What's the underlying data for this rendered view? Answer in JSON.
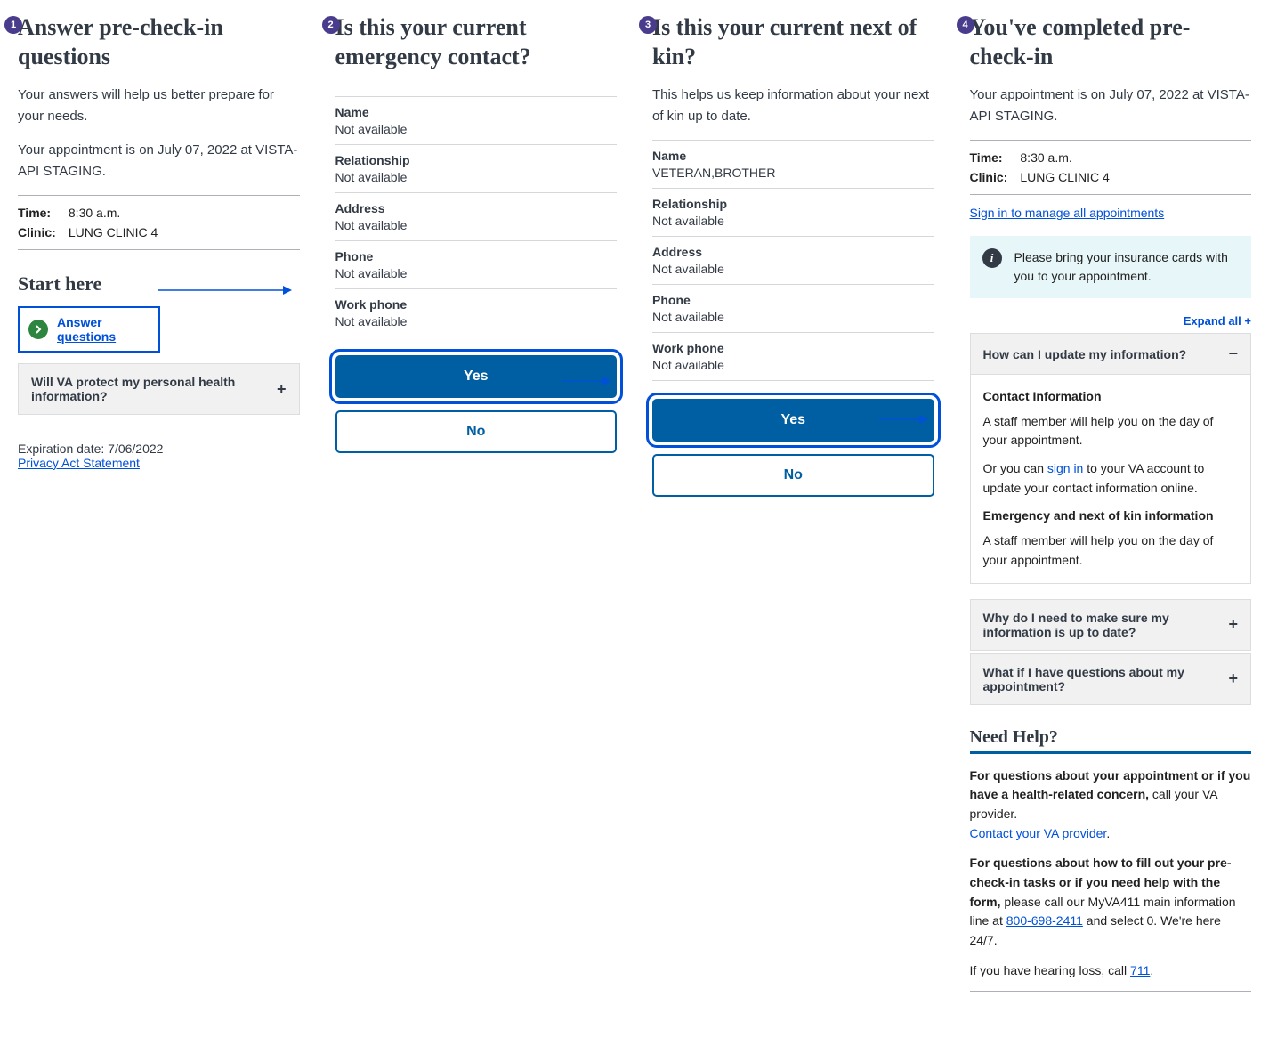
{
  "panels": {
    "p1": {
      "step": "1",
      "title": "Answer pre-check-in questions",
      "intro": "Your answers will help us better prepare for your needs.",
      "appt": "Your appointment is on July 07, 2022 at VISTA-API STAGING.",
      "time_label": "Time:",
      "time_value": "8:30 a.m.",
      "clinic_label": "Clinic:",
      "clinic_value": "LUNG CLINIC 4",
      "start_heading": "Start here",
      "answer_link": "Answer questions",
      "accordion1": "Will VA protect my personal health information?",
      "expiration": "Expiration date: 7/06/2022",
      "privacy": "Privacy Act Statement"
    },
    "p2": {
      "step": "2",
      "title": "Is this your current emergency contact?",
      "fields": [
        {
          "label": "Name",
          "value": "Not available"
        },
        {
          "label": "Relationship",
          "value": "Not available"
        },
        {
          "label": "Address",
          "value": "Not available"
        },
        {
          "label": "Phone",
          "value": "Not available"
        },
        {
          "label": "Work phone",
          "value": "Not available"
        }
      ],
      "yes": "Yes",
      "no": "No"
    },
    "p3": {
      "step": "3",
      "title": "Is this your current next of kin?",
      "intro": "This helps us keep information about your next of kin up to date.",
      "fields": [
        {
          "label": "Name",
          "value": "VETERAN,BROTHER"
        },
        {
          "label": "Relationship",
          "value": "Not available"
        },
        {
          "label": "Address",
          "value": "Not available"
        },
        {
          "label": "Phone",
          "value": "Not available"
        },
        {
          "label": "Work phone",
          "value": "Not available"
        }
      ],
      "yes": "Yes",
      "no": "No"
    },
    "p4": {
      "step": "4",
      "title": "You've completed pre-check-in",
      "appt": "Your appointment is on July 07, 2022 at VISTA-API STAGING.",
      "time_label": "Time:",
      "time_value": "8:30 a.m.",
      "clinic_label": "Clinic:",
      "clinic_value": "LUNG CLINIC 4",
      "signin_link": "Sign in to manage all appointments",
      "alert": "Please bring your insurance cards with you to your appointment.",
      "expand_all": "Expand all +",
      "acc1_title": "How can I update my information?",
      "acc1_h1": "Contact Information",
      "acc1_p1": "A staff member will help you on the day of your appointment.",
      "acc1_p2a": "Or you can ",
      "acc1_p2b": "sign in",
      "acc1_p2c": " to your VA account to update your contact information online.",
      "acc1_h2": "Emergency and next of kin information",
      "acc1_p3": "A staff member will help you on the day of your appointment.",
      "acc2_title": "Why do I need to make sure my information is up to date?",
      "acc3_title": "What if I have questions about my appointment?",
      "help_heading": "Need Help?",
      "help1a": "For questions about your appointment or if you have a health-related concern,",
      "help1b": " call your VA provider.",
      "help1_link": "Contact your VA provider",
      "help2a": "For questions about how to fill out your pre-check-in tasks or if you need help with the form,",
      "help2b": " please call our MyVA411 main information line at ",
      "help2_phone": "800-698-2411",
      "help2c": " and select 0. We're here 24/7.",
      "help3a": "If you have hearing loss, call ",
      "help3_phone": "711",
      "help3b": "."
    }
  }
}
